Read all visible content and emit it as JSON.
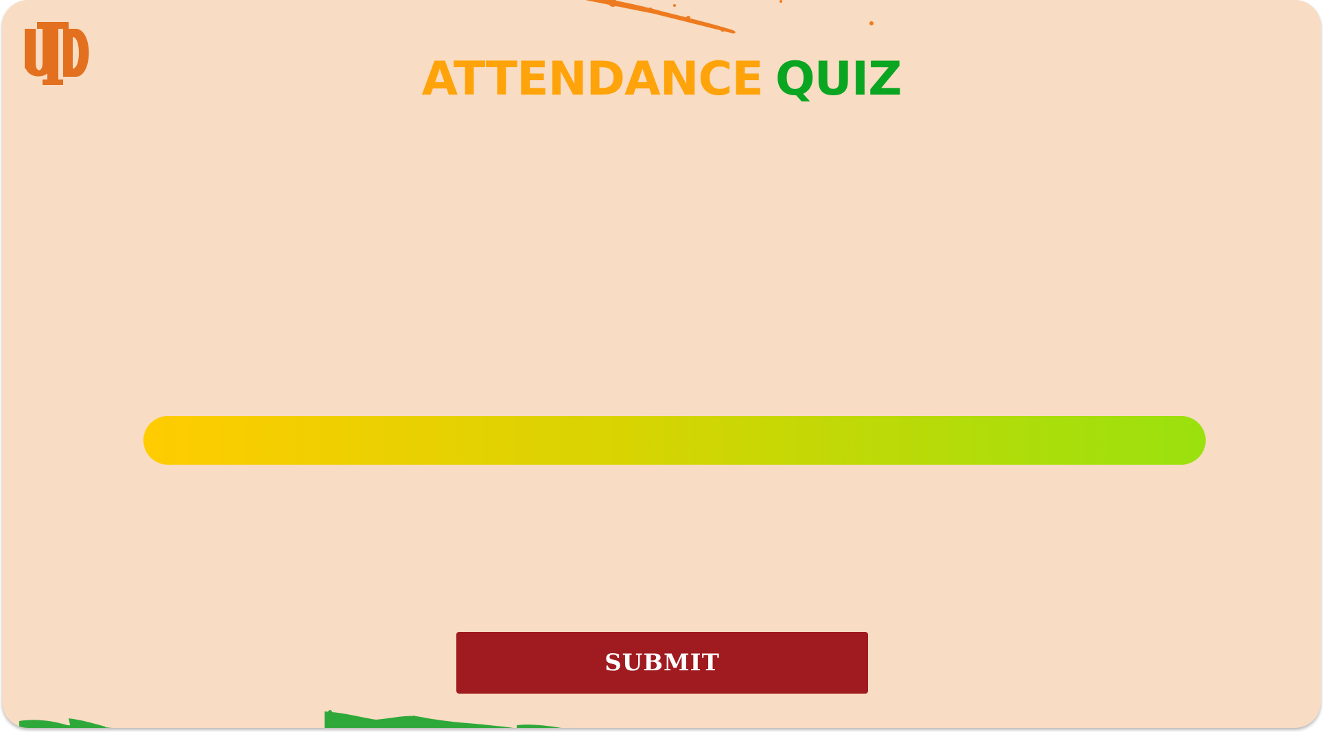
{
  "header": {
    "logo_icon": "utd-logo-icon",
    "logo_text": "UTD",
    "title_part1": "ATTENDANCE",
    "title_part2": "QUIZ"
  },
  "progress": {
    "value_fraction": 1.0
  },
  "actions": {
    "submit_label": "SUBMIT"
  },
  "colors": {
    "background": "#f8dcc3",
    "title_orange": "#ffa30a",
    "title_green": "#0aa521",
    "progress_start": "#ffcc00",
    "progress_end": "#9ae10e",
    "submit_bg": "#9f1b1f",
    "logo": "#e2701e"
  }
}
